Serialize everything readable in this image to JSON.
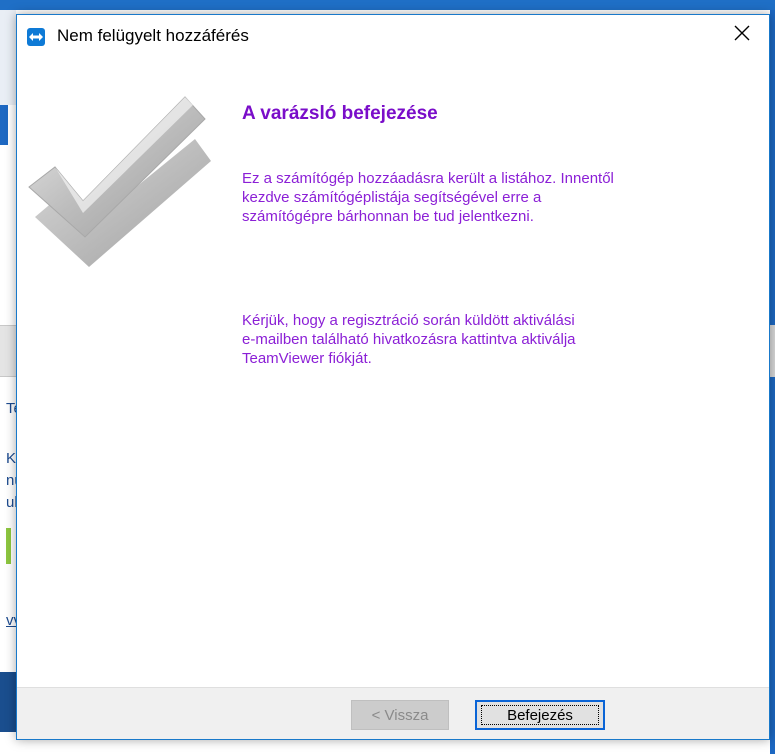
{
  "background": {
    "fragments": [
      "Te",
      "Ké",
      "nu",
      "ul",
      "vv"
    ]
  },
  "dialog": {
    "title": "Nem felügyelt hozzáférés",
    "close_glyph": "✕",
    "heading": "A varázsló befejezése",
    "paragraph1_lines": [
      "Ez a számítógép hozzáadásra került a listához. Innentől",
      "kezdve számítógéplistája segítségével erre a",
      "számítógépre bárhonnan be tud jelentkezni."
    ],
    "paragraph2_lines": [
      "Kérjük, hogy a regisztráció során küldött aktiválási",
      "e-mailben található hivatkozásra kattintva aktiválja",
      "TeamViewer fiókját."
    ],
    "buttons": {
      "back_label": "< Vissza",
      "finish_label": "Befejezés"
    },
    "icons": {
      "app": "teamviewer-icon",
      "close": "close-icon",
      "graphic": "checkmark-icon"
    }
  },
  "colors": {
    "heading": "#7a0dc9",
    "text": "#8b1fd6",
    "accent": "#0a64d6"
  }
}
